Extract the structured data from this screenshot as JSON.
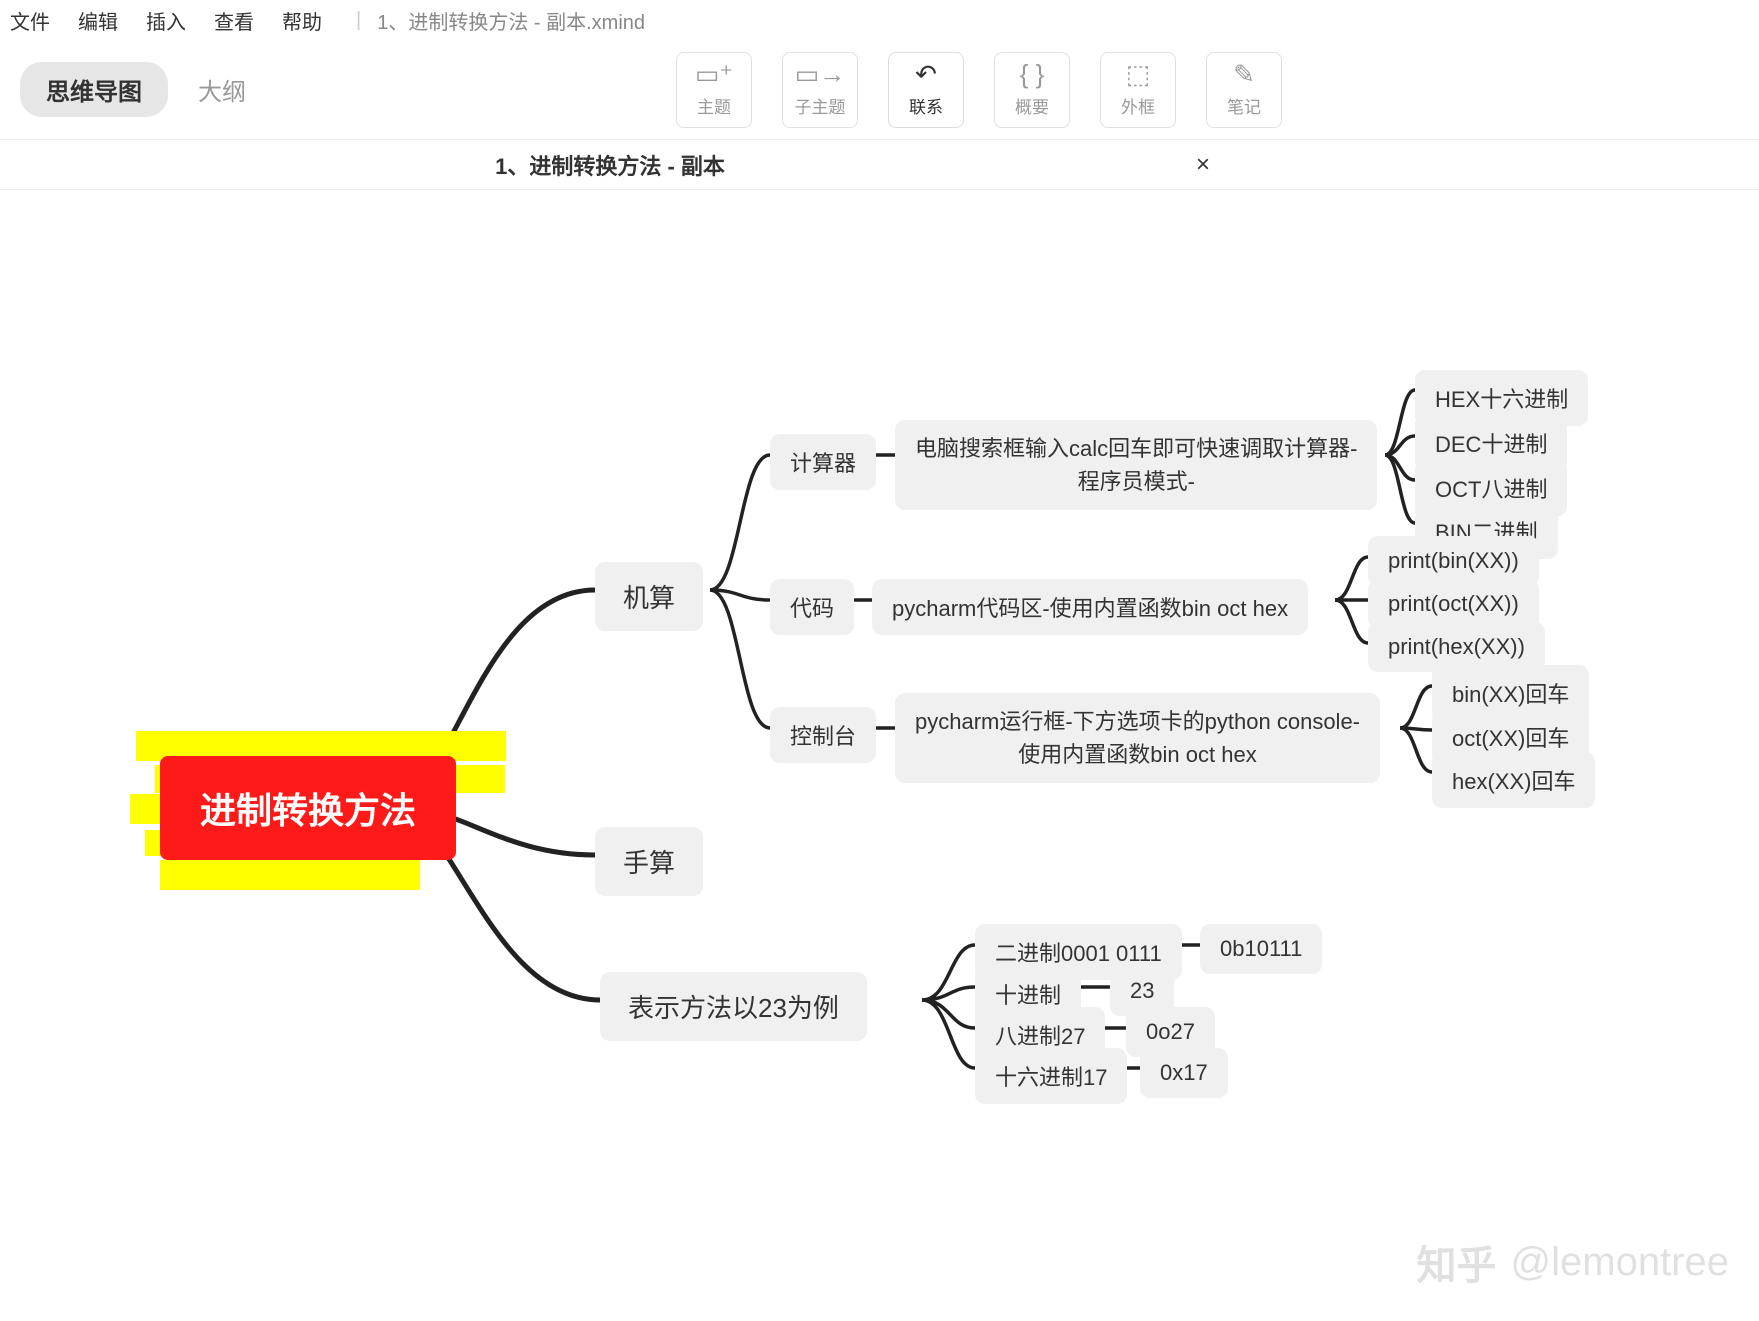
{
  "menu": {
    "file": "文件",
    "edit": "编辑",
    "insert": "插入",
    "view": "查看",
    "help": "帮助",
    "filename": "1、进制转换方法 - 副本.xmind"
  },
  "viewtoggle": {
    "mindmap": "思维导图",
    "outline": "大纲"
  },
  "tools": {
    "topic": "主题",
    "subtopic": "子主题",
    "relationship": "联系",
    "summary": "概要",
    "boundary": "外框",
    "notes": "笔记"
  },
  "tab": {
    "title": "1、进制转换方法 - 副本",
    "close": "×"
  },
  "mindmap": {
    "root": "进制转换方法",
    "machine": {
      "title": "机算",
      "calc": {
        "title": "计算器",
        "desc": "电脑搜索框输入calc回车即可快速调取计算器-\n程序员模式-",
        "hex": "HEX十六进制",
        "dec": "DEC十进制",
        "oct": "OCT八进制",
        "bin": "BIN二进制"
      },
      "code": {
        "title": "代码",
        "desc": "pycharm代码区-使用内置函数bin oct hex",
        "b": "print(bin(XX))",
        "o": "print(oct(XX))",
        "h": "print(hex(XX))"
      },
      "console": {
        "title": "控制台",
        "desc": "pycharm运行框-下方选项卡的python console-\n使用内置函数bin oct hex",
        "b": "bin(XX)回车",
        "o": "oct(XX)回车",
        "h": "hex(XX)回车"
      }
    },
    "manual": {
      "title": "手算"
    },
    "notation": {
      "title": "表示方法以23为例",
      "bin": {
        "k": "二进制0001 0111",
        "v": "0b10111"
      },
      "dec": {
        "k": "十进制",
        "v": "23"
      },
      "oct": {
        "k": "八进制27",
        "v": "0o27"
      },
      "hex": {
        "k": "十六进制17",
        "v": "0x17"
      }
    }
  },
  "watermark": {
    "logo": "知乎",
    "user": "@lemontree"
  }
}
